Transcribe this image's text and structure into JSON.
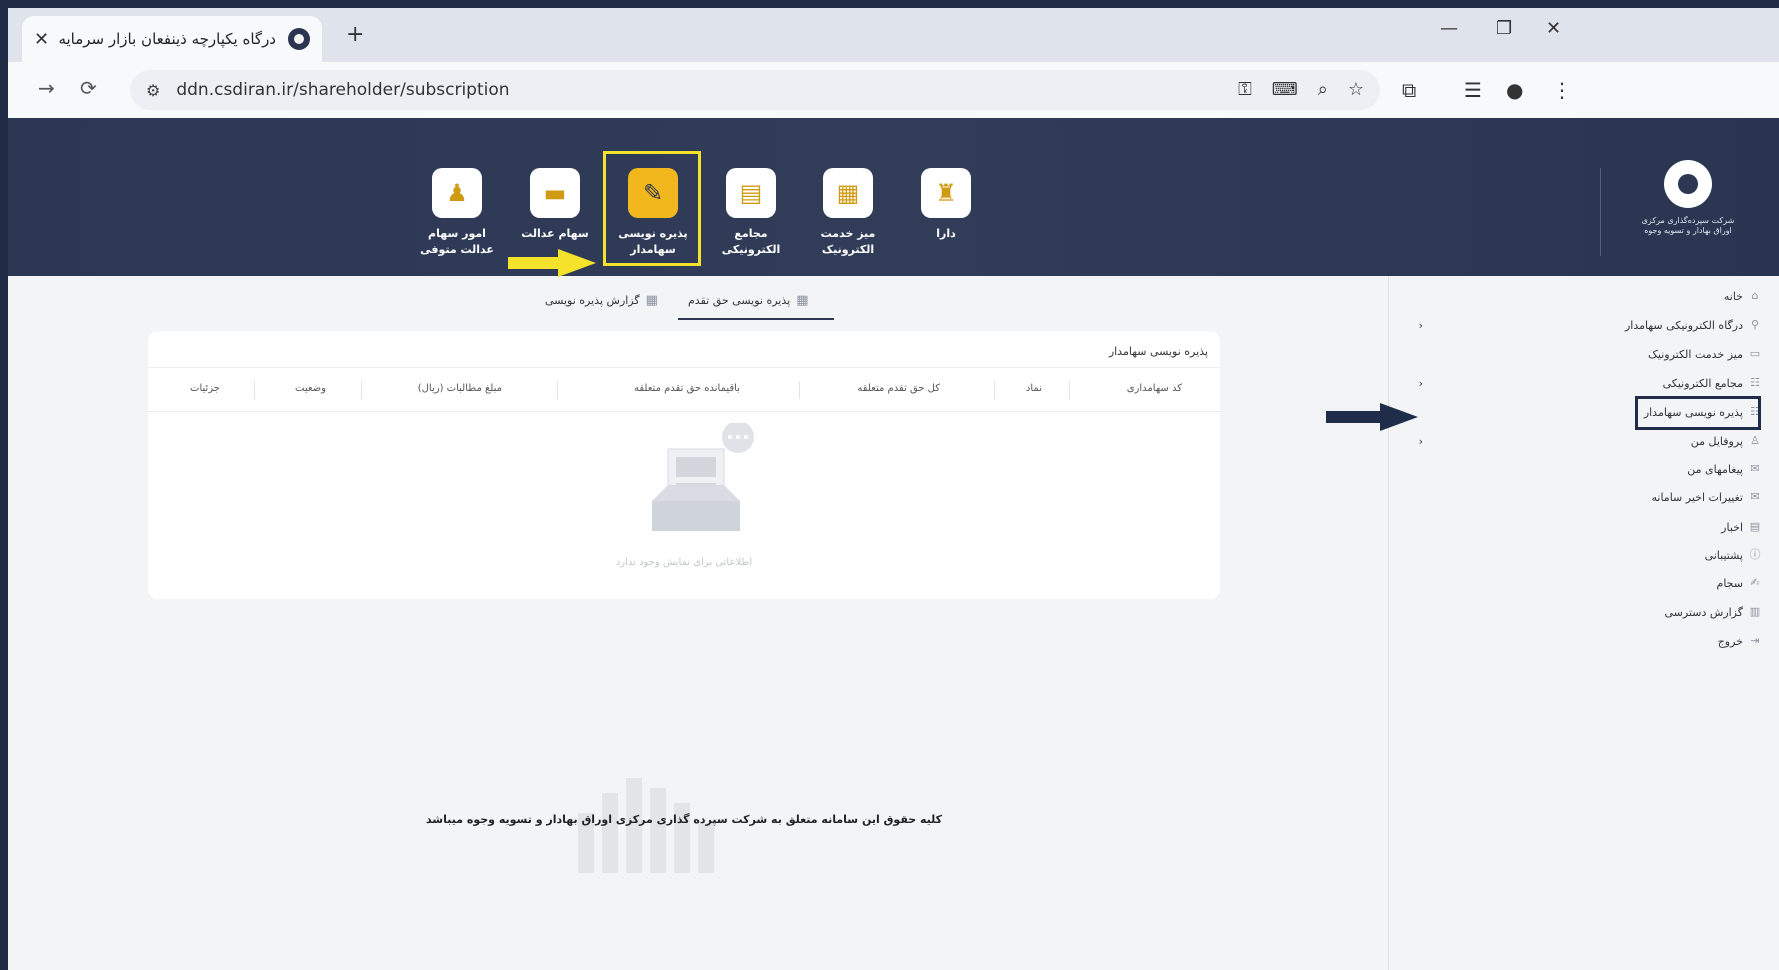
{
  "browser": {
    "tab_title": "درگاه یکپارچه ذینفعان بازار سرمایه",
    "url": "ddn.csdiran.ir/shareholder/subscription"
  },
  "header": {
    "logo_line1": "شرکت سپرده‌گذاری مرکزی",
    "logo_line2": "اوراق بهادار و تسویه وجوه",
    "menu": [
      {
        "label": "دارا",
        "icon": "dara-icon"
      },
      {
        "label": "میز خدمت الکترونیک",
        "icon": "service-desk-icon"
      },
      {
        "label": "مجامع الکترونیکی",
        "icon": "assembly-icon"
      },
      {
        "label": "پذیره نویسی سهامدار",
        "icon": "subscription-icon",
        "active": true
      },
      {
        "label": "سهام عدالت",
        "icon": "edalat-shares-icon"
      },
      {
        "label": "امور سهام عدالت متوفی",
        "icon": "deceased-shares-icon"
      }
    ]
  },
  "sidebar": {
    "items": [
      {
        "label": "خانه"
      },
      {
        "label": "درگاه الکترونیکی سهامدار"
      },
      {
        "label": "میز خدمت الکترونیک"
      },
      {
        "label": "مجامع الکترونیکی"
      },
      {
        "label": "پذیره نویسی سهامدار",
        "active": true
      },
      {
        "label": "پروفایل من"
      },
      {
        "label": "پیغامهای من"
      },
      {
        "label": "تغییرات اخیر سامانه"
      },
      {
        "label": "اخبار"
      },
      {
        "label": "پشتیبانی"
      },
      {
        "label": "سجام"
      },
      {
        "label": "گزارش دسترسی"
      },
      {
        "label": "خروج"
      }
    ]
  },
  "main": {
    "tabs": [
      {
        "label": "پذیره نویسی حق تقدم",
        "active": true
      },
      {
        "label": "گزارش پذیره نویسی"
      }
    ],
    "card_title": "پذیره نویسی سهامدار",
    "columns": [
      "کد سهامداری",
      "نماد",
      "کل حق تقدم متعلقه",
      "باقیمانده حق تقدم متعلقه",
      "مبلغ مطالبات (ریال)",
      "وضعیت",
      "جزئیات"
    ],
    "empty_text": "اطلاعاتی برای نمایش وجود ندارد"
  },
  "footer": {
    "copyright": "کلیه حقوق این سامانه متعلق به شرکت سپرده گذاری مرکزی اوراق بهادار و تسویه وجوه میباشد"
  },
  "colors": {
    "header_bg": "#2c3853",
    "accent": "#f1b71d",
    "highlight_box": "#f5e22a",
    "annotation_arrow_yellow": "#f5e22a",
    "annotation_arrow_dark": "#1f2d4a"
  }
}
